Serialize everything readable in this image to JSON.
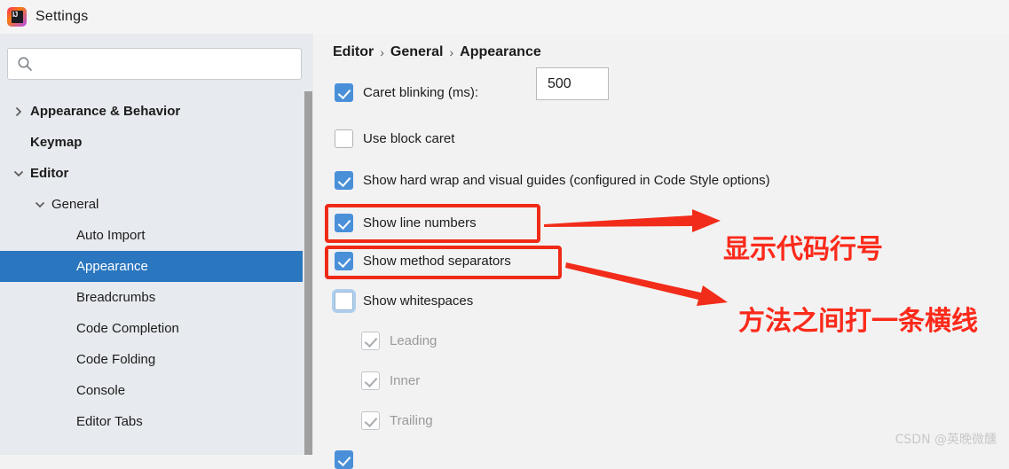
{
  "window": {
    "title": "Settings",
    "logo_icon": "intellij-idea-logo"
  },
  "sidebar": {
    "search": {
      "value": "",
      "placeholder": "",
      "icon": "search-icon"
    },
    "tree": [
      {
        "label": "Appearance & Behavior",
        "level": 0,
        "twisty": "chevron-right-icon",
        "bold": true,
        "selected": false
      },
      {
        "label": "Keymap",
        "level": 0,
        "twisty": "none",
        "bold": true,
        "selected": false
      },
      {
        "label": "Editor",
        "level": 0,
        "twisty": "chevron-down-icon",
        "bold": true,
        "selected": false
      },
      {
        "label": "General",
        "level": 1,
        "twisty": "chevron-down-icon",
        "bold": false,
        "selected": false
      },
      {
        "label": "Auto Import",
        "level": 2,
        "twisty": "none",
        "bold": false,
        "selected": false
      },
      {
        "label": "Appearance",
        "level": 2,
        "twisty": "none",
        "bold": false,
        "selected": true
      },
      {
        "label": "Breadcrumbs",
        "level": 2,
        "twisty": "none",
        "bold": false,
        "selected": false
      },
      {
        "label": "Code Completion",
        "level": 2,
        "twisty": "none",
        "bold": false,
        "selected": false
      },
      {
        "label": "Code Folding",
        "level": 2,
        "twisty": "none",
        "bold": false,
        "selected": false
      },
      {
        "label": "Console",
        "level": 2,
        "twisty": "none",
        "bold": false,
        "selected": false
      },
      {
        "label": "Editor Tabs",
        "level": 2,
        "twisty": "none",
        "bold": false,
        "selected": false
      }
    ]
  },
  "main": {
    "breadcrumb": {
      "part1": "Editor",
      "sep1": "›",
      "part2": "General",
      "sep2": "›",
      "part3": "Appearance"
    },
    "options": [
      {
        "label": "Caret blinking (ms):",
        "state": "checked",
        "indent": 0
      },
      {
        "label": "Use block caret",
        "state": "unchecked",
        "indent": 0
      },
      {
        "label": "Show hard wrap and visual guides (configured in Code Style options)",
        "state": "checked",
        "indent": 0
      },
      {
        "label": "Show line numbers",
        "state": "checked",
        "indent": 0
      },
      {
        "label": "Show method separators",
        "state": "checked",
        "indent": 0
      },
      {
        "label": "Show whitespaces",
        "state": "unchecked-focused",
        "indent": 0
      },
      {
        "label": "Leading",
        "state": "checked-disabled",
        "indent": 1
      },
      {
        "label": "Inner",
        "state": "checked-disabled",
        "indent": 1
      },
      {
        "label": "Trailing",
        "state": "checked-disabled",
        "indent": 1
      }
    ],
    "caret_blinking_value": "500"
  },
  "annotations": {
    "note1": "显示代码行号",
    "note2": "方法之间打一条横线",
    "color": "#fb2a1b",
    "box_color": "#ef2a17"
  },
  "watermark": "CSDN @英晚微醺"
}
